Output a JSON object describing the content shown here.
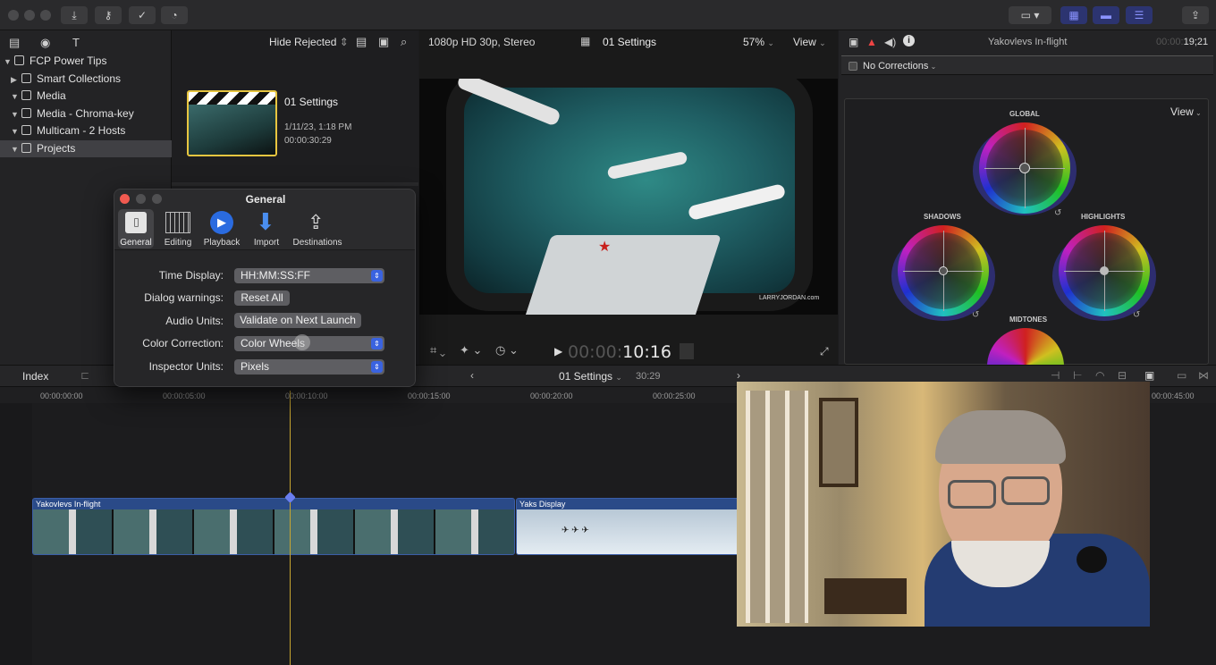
{
  "toolbar": {
    "buttons": [
      "import-icon",
      "keyword-icon",
      "check-icon",
      "background-tasks-icon"
    ],
    "right_buttons": [
      "workspace-icon",
      "browser-layout-icon",
      "timeline-layout-icon",
      "inspector-layout-icon",
      "share-icon"
    ]
  },
  "sidebar": {
    "items": [
      {
        "label": "FCP Power Tips",
        "expanded": true,
        "icon": "library-icon"
      },
      {
        "label": "Smart Collections",
        "expanded": false,
        "icon": "folder-icon"
      },
      {
        "label": "Media",
        "expanded": true,
        "icon": "event-icon"
      },
      {
        "label": "Media - Chroma-key",
        "expanded": true,
        "icon": "event-icon"
      },
      {
        "label": "Multicam - 2 Hosts",
        "expanded": true,
        "icon": "event-icon"
      },
      {
        "label": "Projects",
        "expanded": true,
        "icon": "event-icon",
        "selected": true
      }
    ]
  },
  "browser": {
    "filter": "Hide Rejected",
    "clip": {
      "title": "01 Settings",
      "date": "1/11/23, 1:18 PM",
      "duration": "00:00:30:29"
    }
  },
  "viewer": {
    "format": "1080p HD 30p, Stereo",
    "project": "01 Settings",
    "zoom": "57%",
    "view": "View",
    "watermark": "LARRYJORDAN.com",
    "timecode_dim": "00:00:",
    "timecode_main": "10:16"
  },
  "inspector": {
    "clip_name": "Yakovlevs In-flight",
    "timecode_dim": "00:00:",
    "timecode_main": "19;21",
    "corrections": "No Corrections",
    "view": "View",
    "wheels": {
      "global": "GLOBAL",
      "shadows": "SHADOWS",
      "highlights": "HIGHLIGHTS",
      "midtones": "MIDTONES"
    }
  },
  "dialog": {
    "title": "General",
    "tabs": [
      {
        "label": "General",
        "icon": "switch-icon"
      },
      {
        "label": "Editing",
        "icon": "film-icon"
      },
      {
        "label": "Playback",
        "icon": "play-icon"
      },
      {
        "label": "Import",
        "icon": "download-arrow-icon"
      },
      {
        "label": "Destinations",
        "icon": "share-icon"
      }
    ],
    "rows": {
      "time_display_label": "Time Display:",
      "time_display_value": "HH:MM:SS:FF",
      "dialog_warnings_label": "Dialog warnings:",
      "reset_all": "Reset All",
      "audio_units_label": "Audio Units:",
      "validate": "Validate on Next Launch",
      "color_correction_label": "Color Correction:",
      "color_correction_value": "Color Wheels",
      "inspector_units_label": "Inspector Units:",
      "inspector_units_value": "Pixels"
    }
  },
  "timeline": {
    "index": "Index",
    "project": "01 Settings",
    "duration": "30:29",
    "ruler": [
      "00:00:00:00",
      "00:00:05:00",
      "00:00:10:00",
      "00:00:15:00",
      "00:00:20:00",
      "00:00:25:00",
      "00:00:45:00"
    ],
    "clips": [
      {
        "title": "Yakovlevs In-flight"
      },
      {
        "title": "Yaks Display"
      }
    ]
  }
}
